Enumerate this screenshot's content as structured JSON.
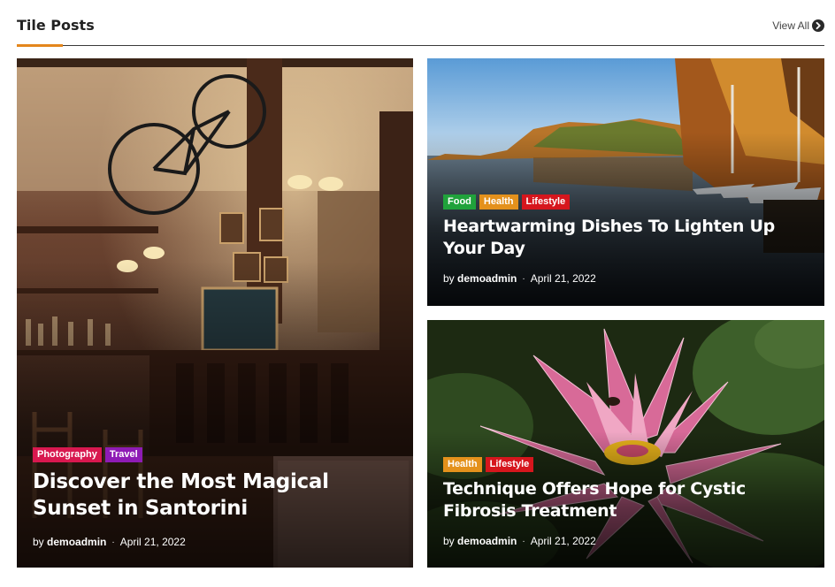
{
  "section": {
    "title": "Tile Posts",
    "view_all": "View All",
    "accent_color": "#e4861c"
  },
  "posts": [
    {
      "title": "Discover the Most Magical Sunset in Santorini",
      "tags": [
        "Photography",
        "Travel"
      ],
      "author_prefix": "by",
      "author": "demoadmin",
      "date": "April 21, 2022",
      "image": "pub-interior"
    },
    {
      "title": "Heartwarming Dishes To Lighten Up Your Day",
      "tags": [
        "Food",
        "Health",
        "Lifestyle"
      ],
      "author_prefix": "by",
      "author": "demoadmin",
      "date": "April 21, 2022",
      "image": "autumn-lake"
    },
    {
      "title": "Technique Offers Hope for Cystic Fibrosis Treatment",
      "tags": [
        "Health",
        "Lifestyle"
      ],
      "author_prefix": "by",
      "author": "demoadmin",
      "date": "April 21, 2022",
      "image": "pink-water-lily"
    }
  ],
  "tag_colors": {
    "Photography": "#d8184f",
    "Travel": "#8e1bb5",
    "Food": "#20a23b",
    "Health": "#e4911c",
    "Lifestyle": "#d6161d"
  }
}
